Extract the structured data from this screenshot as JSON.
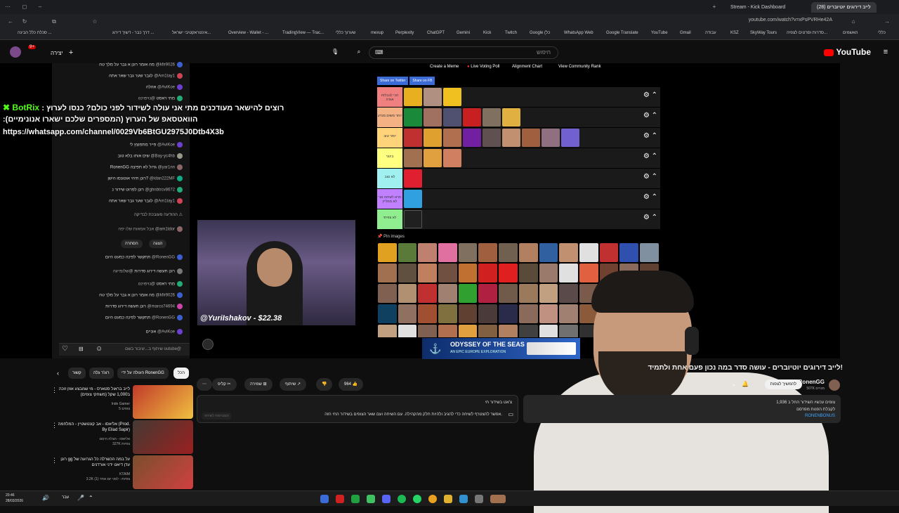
{
  "browser": {
    "tabs": [
      "Stream - Kick Dashboard",
      "לייב דירוגים יוטיוברים (28)"
    ],
    "url": "youtube.com/watch?v=xPsPVRHe42A",
    "bookmarks": [
      "סכלת כלל הבינה ...",
      "דרך כבר - דשיך דירוג ...",
      "אינטראקטיבי ישראל...",
      "Overview - Wallet - ...",
      "TradingView — Trac...",
      "שערוך כללי",
      "mexup",
      "Perplexity",
      "ChatGPT",
      "Gemini",
      "Kick",
      "Twitch",
      "Google (כל",
      "WhatsApp Web",
      "Google Translate",
      "YouTube",
      "Gmail",
      "עבודה",
      "KSZ",
      "SkyWay Tours",
      "סדרות וסרטים לצפיה...",
      "האשמים",
      "כללי"
    ]
  },
  "masthead": {
    "logo": "YouTube",
    "search_placeholder": "חיפוש",
    "create_label": "יצירה",
    "notif_count": "9+"
  },
  "chat": {
    "messages": [
      {
        "user": "@kfir9026",
        "text": "מה אומר רונן א גבר על מלך טה"
      },
      {
        "user": "@Am1tay1",
        "text": "לגבר שער גבר שאר אתה"
      },
      {
        "user": "@AviKoe",
        "text": "אהלה"
      },
      {
        "user": "@נויפוינט",
        "text": "מתי ראסט"
      },
      {
        "user": "@AviKoe",
        "text": "פייר מתפוצץ לי"
      },
      {
        "user": "@Bay-yc4hb",
        "text": "שים אותו בלא טוב"
      },
      {
        "user": "@yar1nn",
        "text": "RonenGG גדול לא תפיצה"
      },
      {
        "user": "@idan222MF",
        "text": "רונן תיהי אוטונסו הישן?"
      },
      {
        "user": "@ghnbtrcv8672",
        "text": "רונן לפרוט שידור נ"
      },
      {
        "user": "@Am1tay1",
        "text": "לגבר שער גבר שאר אתה"
      },
      {
        "user": "@am1tdor",
        "text": "אבל אמאות שלו יפה"
      },
      {
        "user": "@RonenGG",
        "text": "תתקשר לפינה כמעט היום"
      },
      {
        "user": "@שלומייגה",
        "text": "רונן תעשה דירוג סדרות"
      },
      {
        "user": "@נויפוינט",
        "text": "מתי ראסט"
      },
      {
        "user": "@kfir9026",
        "text": "מה אומר רונן א גבר על מלך טה"
      },
      {
        "user": "@marco74694",
        "text": "רונן תעשה דירוג סדרות"
      },
      {
        "user": "@RonenGG",
        "text": "תתקשר לפינה כמעט היום"
      },
      {
        "user": "@AviKoe",
        "text": "אוניים"
      }
    ],
    "moderation_note": "ההודעה מעובכת לבדיקה",
    "hide_label": "הסתרה",
    "show_label": "הצגה",
    "input_placeholder": "שיתוף ב...יציבור בשם outube@",
    "botrix_name": "BotRix",
    "botrix_line1": ": רוצים להישאר מעודכנים מתי אני עולה לשידור לפני כולם? כנסו לערוץ",
    "botrix_line2": ":הוואטסאפ של הערוץ (המספרים שלכם ישארו אנונימיים)",
    "botrix_link": "https://whatsapp.com/channel/0029Vb6BtGU2975J0Dtb4X3b"
  },
  "stream": {
    "webcam_caption": "@YuriIshakov - $22.38",
    "tier_buttons": [
      "Create a Meme",
      "Live Voting Poll",
      "Alignment Chart",
      "View Community Rank"
    ],
    "share_twitter": "Share on Twitter",
    "share_fb": "Share on FB",
    "tiers": [
      {
        "label": "הכי לבבלות אגדה",
        "color": "#f08080",
        "items": 3
      },
      {
        "label": "יותר משים מנדע",
        "color": "#f4b183",
        "items": 6
      },
      {
        "label": "יותר טוב",
        "color": "#ffd37a",
        "items": 9
      },
      {
        "label": "בינוני",
        "color": "#ffff80",
        "items": 3
      },
      {
        "label": "לא טוב",
        "color": "#a0f0f0",
        "items": 1
      },
      {
        "label": "חרא לשיחה אני לא ממליץ",
        "color": "#c080ff",
        "items": 1
      },
      {
        "label": "לא צפיתי",
        "color": "#90ee90",
        "items": 1
      }
    ],
    "pin_images_label": "Pin images",
    "ad_title": "ODYSSEY OF THE SEAS",
    "ad_sub": "AN EPIC EUROPE EXPLORATION"
  },
  "video": {
    "title": "לייב דירוגים יוטיוברים - עושה סדר במה נכון פעם אחת ולתמיד!",
    "channel": "RonenGG",
    "subs": "507K מנויים",
    "subscribe_label": "להמשיך לצפות",
    "likes": "964",
    "share_label": "שיתוף",
    "save_label": "שמירה",
    "clip_label": "קליפ",
    "desc_views": "1,936 צופים עכשיו  השידור החל ב",
    "desc_line2": "לקבלת הפנות מפרסם",
    "desc_link": "RONENBONUS",
    "livechat_title": "צ'אט בשידור חי",
    "livechat_note": "אפשר להצטרף לשיחה כדי להגיב ולהיות חלק מהקהילה. עם השיחה ועם שאר הצופים בשידור החי הזה.",
    "livechat_button": "הצטרפות לשיחה"
  },
  "recommendations": {
    "chips": [
      "הכל",
      "העולה על ידי RonenGG",
      "רוג'ר גלה",
      "קשור"
    ],
    "items": [
      {
        "title": "לייב בראול סטארס - מי שמבצע אוזן זוכה ב1,000 שקל (משחקי צופים)",
        "channel": "Inde Gamer",
        "meta": "5 צופים",
        "thumb": "#c23a2a"
      },
      {
        "title": "אליאסו - אב קונטשטיין - המלחמה (Prod. By Eliad Sapir)",
        "channel": "אליאסו - הצלה הינזם",
        "meta": "327K צפיות",
        "thumb": "#443a33"
      },
      {
        "title": "רונן gg על במה הכשרלה כל הגרועה של עדן דיאט ידני אורדנים",
        "channel": "KTAIM",
        "meta": "3.2K צפיות - לפני יום אחד (1)",
        "thumb": "#7a4f2e"
      }
    ]
  },
  "taskbar": {
    "time": "20:46",
    "date": "28/03/2026",
    "lang": "עבר"
  }
}
